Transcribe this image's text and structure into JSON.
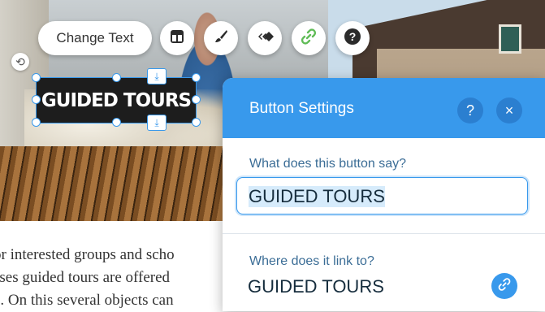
{
  "toolbar": {
    "change_text_label": "Change Text",
    "buttons": [
      {
        "name": "layout-icon"
      },
      {
        "name": "paintbrush-icon"
      },
      {
        "name": "animation-icon"
      },
      {
        "name": "link-icon"
      },
      {
        "name": "help-icon",
        "glyph": "?"
      }
    ]
  },
  "element": {
    "button_text": "GUIDED TOURS"
  },
  "page_text": {
    "lines": [
      "or interested groups and scho",
      "sses guided tours are offered",
      "e. On this several objects can"
    ]
  },
  "panel": {
    "title": "Button Settings",
    "help_glyph": "?",
    "close_glyph": "×",
    "text_label": "What does this button say?",
    "text_value": "GUIDED TOURS",
    "link_label": "Where does it link to?",
    "link_value": "GUIDED TOURS"
  },
  "colors": {
    "accent": "#3899ec",
    "header_button": "#2b7fd0",
    "element_bg": "#1d1d1d",
    "text_dark": "#162d3d",
    "label_text": "#3b6d96"
  }
}
